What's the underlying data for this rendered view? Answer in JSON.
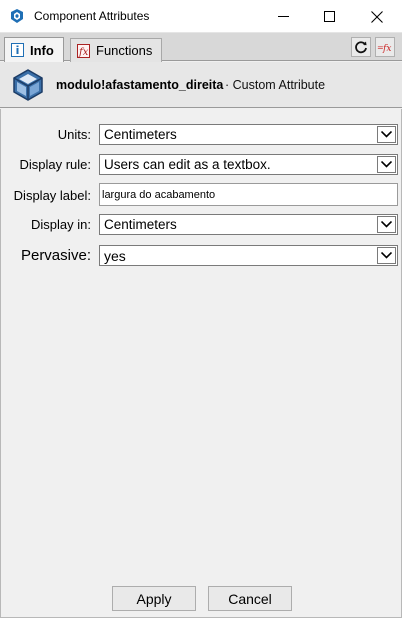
{
  "window": {
    "title": "Component Attributes",
    "app_icon": "sketchup-icon",
    "controls": [
      "minimize-icon",
      "maximize-icon",
      "close-icon"
    ]
  },
  "tabs": [
    {
      "label": "Info",
      "icon": "info-icon",
      "active": true
    },
    {
      "label": "Functions",
      "icon": "function-icon",
      "active": false
    }
  ],
  "toolbar": {
    "icons": [
      "refresh-icon",
      "formula-icon"
    ]
  },
  "header": {
    "component_name": "modulo!afastamento_direita",
    "separator": "·",
    "attribute_type": "Custom Attribute",
    "icon": "component-cube-icon"
  },
  "form": {
    "units": {
      "label": "Units:",
      "value": "Centimeters"
    },
    "display_rule": {
      "label": "Display rule:",
      "value": "Users can edit as a textbox."
    },
    "display_label": {
      "label": "Display label:",
      "value": "largura do acabamento"
    },
    "display_in": {
      "label": "Display in:",
      "value": "Centimeters"
    },
    "pervasive": {
      "label": "Pervasive:",
      "value": "yes"
    }
  },
  "buttons": {
    "apply": "Apply",
    "cancel": "Cancel"
  },
  "colors": {
    "titlebar_bg": "#ffffff",
    "panel_bg": "#f0f0f0",
    "tab_strip_bg": "#d8d8d8",
    "formula_red": "#cc2222",
    "icon_blue": "#1f6fb5"
  }
}
